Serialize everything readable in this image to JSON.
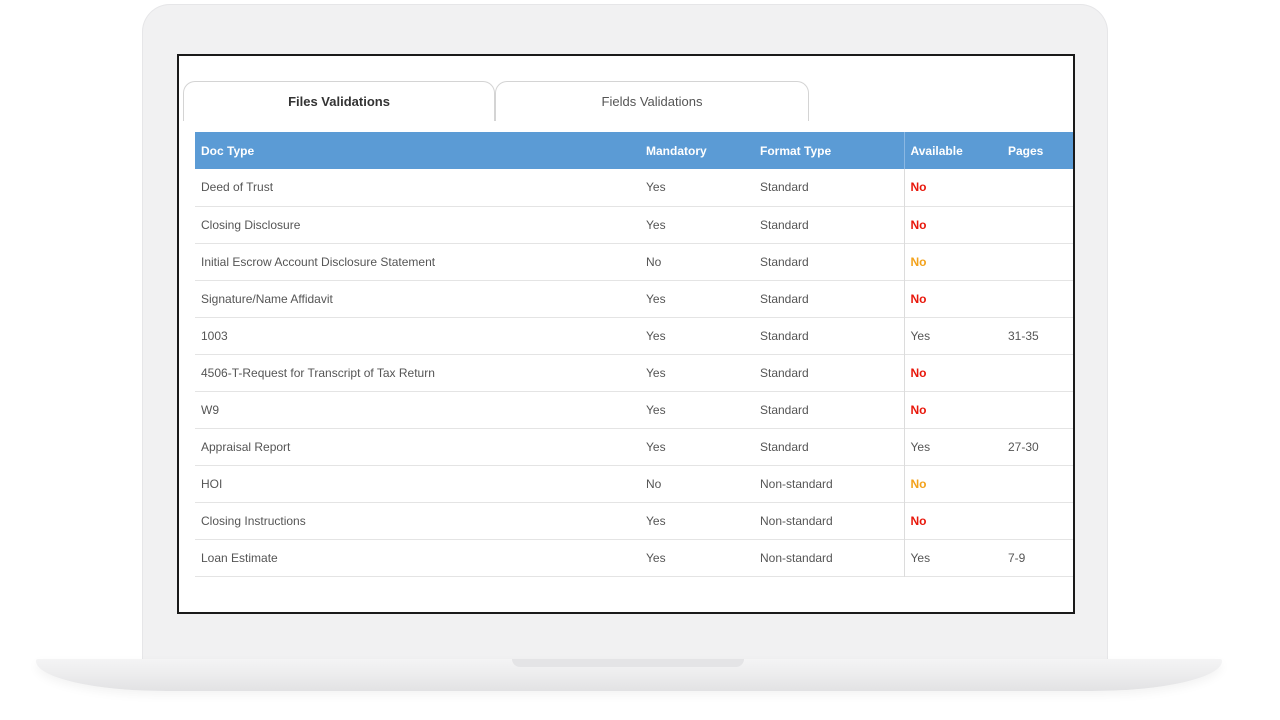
{
  "tabs": [
    {
      "label": "Files Validations",
      "active": true
    },
    {
      "label": "Fields Validations",
      "active": false
    }
  ],
  "table": {
    "columns": [
      "Doc Type",
      "Mandatory",
      "Format Type",
      "Available",
      "Pages"
    ],
    "rows": [
      {
        "doc_type": "Deed of Trust",
        "mandatory": "Yes",
        "format_type": "Standard",
        "available": "No",
        "available_status": "missing-mandatory",
        "pages": ""
      },
      {
        "doc_type": "Closing Disclosure",
        "mandatory": "Yes",
        "format_type": "Standard",
        "available": "No",
        "available_status": "missing-mandatory",
        "pages": ""
      },
      {
        "doc_type": "Initial Escrow Account Disclosure Statement",
        "mandatory": "No",
        "format_type": "Standard",
        "available": "No",
        "available_status": "missing-optional",
        "pages": ""
      },
      {
        "doc_type": "Signature/Name Affidavit",
        "mandatory": "Yes",
        "format_type": "Standard",
        "available": "No",
        "available_status": "missing-mandatory",
        "pages": ""
      },
      {
        "doc_type": "1003",
        "mandatory": "Yes",
        "format_type": "Standard",
        "available": "Yes",
        "available_status": "present",
        "pages": "31-35"
      },
      {
        "doc_type": "4506-T-Request for Transcript of Tax Return",
        "mandatory": "Yes",
        "format_type": "Standard",
        "available": "No",
        "available_status": "missing-mandatory",
        "pages": ""
      },
      {
        "doc_type": "W9",
        "mandatory": "Yes",
        "format_type": "Standard",
        "available": "No",
        "available_status": "missing-mandatory",
        "pages": ""
      },
      {
        "doc_type": "Appraisal Report",
        "mandatory": "Yes",
        "format_type": "Standard",
        "available": "Yes",
        "available_status": "present",
        "pages": "27-30"
      },
      {
        "doc_type": "HOI",
        "mandatory": "No",
        "format_type": "Non-standard",
        "available": "No",
        "available_status": "missing-optional",
        "pages": ""
      },
      {
        "doc_type": "Closing Instructions",
        "mandatory": "Yes",
        "format_type": "Non-standard",
        "available": "No",
        "available_status": "missing-mandatory",
        "pages": ""
      },
      {
        "doc_type": "Loan Estimate",
        "mandatory": "Yes",
        "format_type": "Non-standard",
        "available": "Yes",
        "available_status": "present",
        "pages": "7-9"
      }
    ]
  },
  "colors": {
    "header_bg": "#5b9bd5",
    "missing_mandatory": "#e8170b",
    "missing_optional": "#f3a21b",
    "text": "#555555"
  }
}
